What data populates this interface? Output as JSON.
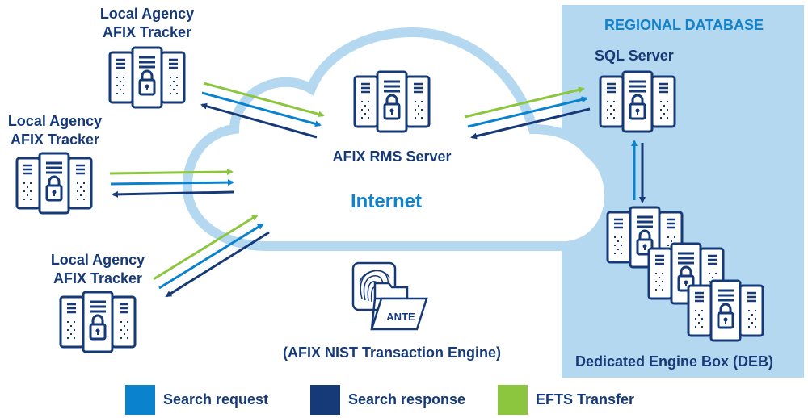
{
  "colors": {
    "search_request": "#0a82cd",
    "search_response": "#163a78",
    "efts_transfer": "#8cc63f",
    "cloud_outline": "#b5d8f1",
    "region_bg": "#b5d8f1",
    "icon_stroke": "#163a78"
  },
  "nodes": {
    "tracker_top": {
      "line1": "Local Agency",
      "line2": "AFIX Tracker"
    },
    "tracker_middle": {
      "line1": "Local Agency",
      "line2": "AFIX Tracker"
    },
    "tracker_bottom": {
      "line1": "Local Agency",
      "line2": "AFIX Tracker"
    },
    "rms_server": {
      "label": "AFIX RMS Server"
    },
    "internet": {
      "label": "Internet"
    },
    "ante": {
      "badge": "ANTE",
      "label": "(AFIX NIST Transaction Engine)"
    },
    "region": {
      "title": "REGIONAL DATABASE",
      "sql_server": "SQL Server",
      "deb": "Dedicated Engine Box (DEB)"
    }
  },
  "legend": [
    {
      "key": "search_request",
      "label": "Search request"
    },
    {
      "key": "search_response",
      "label": "Search response"
    },
    {
      "key": "efts_transfer",
      "label": "EFTS Transfer"
    }
  ]
}
